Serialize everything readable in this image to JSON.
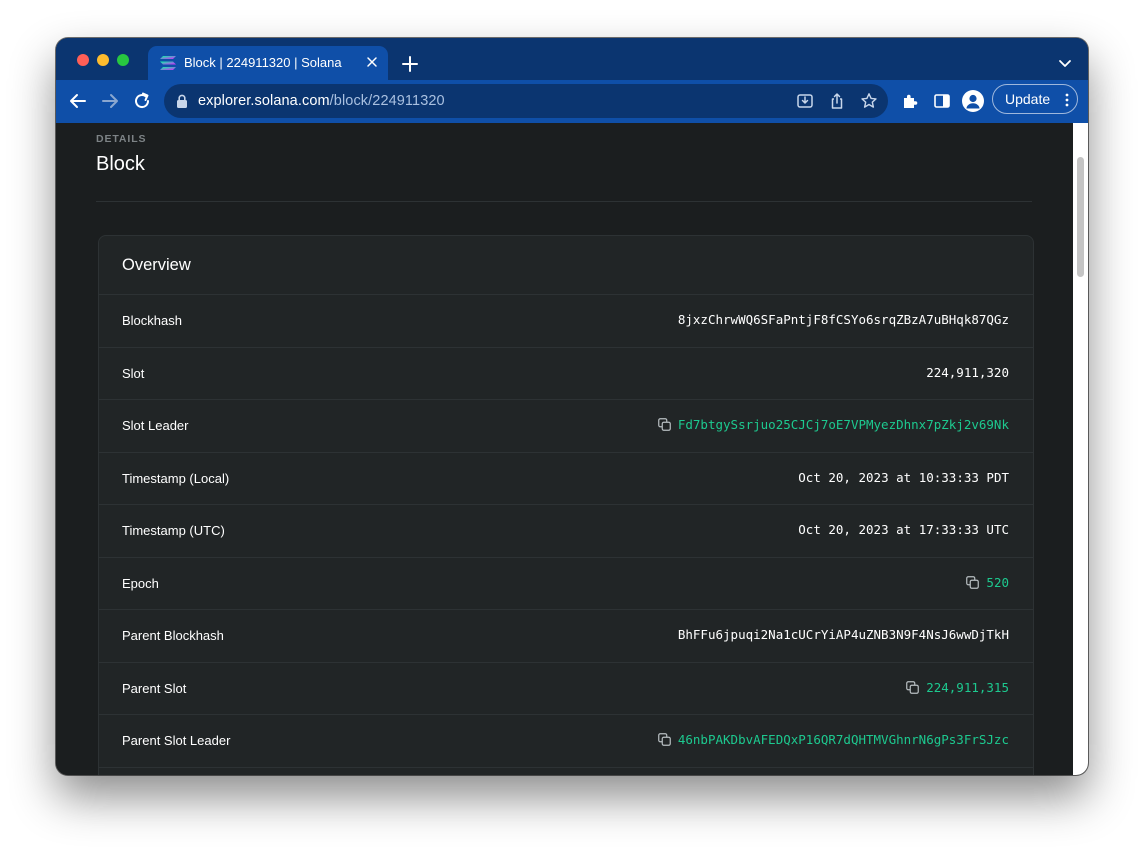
{
  "browser": {
    "tab_title": "Block | 224911320 | Solana",
    "url_host": "explorer.solana.com",
    "url_path": "/block/224911320",
    "update_label": "Update"
  },
  "page": {
    "eyebrow": "DETAILS",
    "title": "Block"
  },
  "overview": {
    "title": "Overview",
    "rows": [
      {
        "label": "Blockhash",
        "value": "8jxzChrwWQ6SFaPntjF8fCSYo6srqZBzA7uBHqk87QGz",
        "link": false
      },
      {
        "label": "Slot",
        "value": "224,911,320",
        "link": false
      },
      {
        "label": "Slot Leader",
        "value": "Fd7btgySsrjuo25CJCj7oE7VPMyezDhnx7pZkj2v69Nk",
        "link": true
      },
      {
        "label": "Timestamp (Local)",
        "value": "Oct 20, 2023 at 10:33:33 PDT",
        "link": false
      },
      {
        "label": "Timestamp (UTC)",
        "value": "Oct 20, 2023 at 17:33:33 UTC",
        "link": false
      },
      {
        "label": "Epoch",
        "value": "520",
        "link": true
      },
      {
        "label": "Parent Blockhash",
        "value": "BhFFu6jpuqi2Na1cUCrYiAP4uZNB3N9F4NsJ6wwDjTkH",
        "link": false
      },
      {
        "label": "Parent Slot",
        "value": "224,911,315",
        "link": true
      },
      {
        "label": "Parent Slot Leader",
        "value": "46nbPAKDbvAFEDQxP16QR7dQHTMVGhnrN6gPs3FrSJzc",
        "link": true
      }
    ]
  },
  "colors": {
    "accent_link": "#1dc98f",
    "tab_bar": "#0b3570",
    "toolbar": "#0f4fa8",
    "page_bg": "#1b1e1f",
    "card_bg": "#212526"
  }
}
